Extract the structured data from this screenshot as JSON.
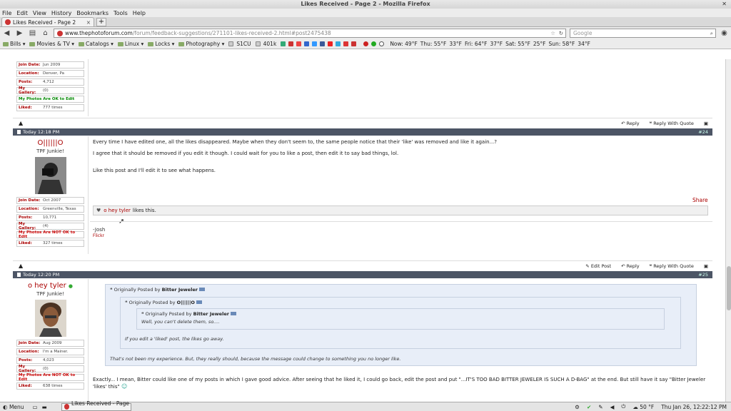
{
  "window": {
    "title": "Likes Received - Page 2 - Mozilla Firefox",
    "close": "✕"
  },
  "menu": [
    "File",
    "Edit",
    "View",
    "History",
    "Bookmarks",
    "Tools",
    "Help"
  ],
  "tab": {
    "label": "Likes Received - Page 2",
    "new_tab": "+",
    "close": "×"
  },
  "nav": {
    "url_domain": "www.thephotoforum.com",
    "url_path": "/forum/feedback-suggestions/271101-likes-received-2.html#post2475438",
    "search_placeholder": "Google"
  },
  "bookmarks": [
    "Bills ▾",
    "Movies & TV ▾",
    "Catalogs ▾",
    "Linux ▾",
    "Locks ▾",
    "Photography ▾",
    "S1CU",
    "401k"
  ],
  "weather": {
    "now": "Now: 49°F",
    "thu": "Thu: 55°F",
    "thu_low": "33°F",
    "fri": "Fri: 64°F",
    "fri_low": "37°F",
    "sat": "Sat: 55°F",
    "sat_low": "25°F",
    "sun": "Sun: 58°F",
    "sun_low": "34°F"
  },
  "stat_labels": {
    "join": "Join Date:",
    "location": "Location:",
    "posts": "Posts:",
    "gallery": "My Gallery:",
    "liked": "Liked:"
  },
  "prev_user": {
    "join": "Jun 2009",
    "location": "Denver, Pa",
    "posts": "4,712",
    "gallery": "(0)",
    "photos": "My Photos Are OK to Edit",
    "liked": "777 times"
  },
  "actions": {
    "reply": "Reply",
    "reply_quote": "Reply With Quote",
    "edit": "Edit Post",
    "share": "Share",
    "likes_this": "likes this."
  },
  "post24": {
    "time": "Today 12:18 PM",
    "number": "#24",
    "user": "O||||||O",
    "user_title": "TPF Junkie!",
    "join": "Oct 2007",
    "location": "Greenville, Texas",
    "posts": "10,771",
    "gallery": "(4)",
    "photos": "My Photos Are NOT OK to Edit",
    "liked": "327 times",
    "p1": "Every time I have edited one, all the likes disappeared. Maybe when they don't seem to, the same people notice that their 'like' was removed and like it again...?",
    "p2": "I agree that it should be removed if you edit it though. I could wait for you to like a post, then edit it to say bad things, lol.",
    "p3": "Like this post and I'll edit it to see what happens.",
    "liker": "o hey tyler",
    "sig1": "-Josh",
    "sig2": "Flickr"
  },
  "post25": {
    "time": "Today 12:20 PM",
    "number": "#25",
    "user": "o hey tyler",
    "user_title": "TPF Junkie!",
    "join": "Aug 2009",
    "location": "I'm a Mainer.",
    "posts": "4,023",
    "gallery": "(0)",
    "photos": "My Photos Are NOT OK to Edit",
    "liked": "638 times",
    "q_prefix": "Originally Posted by",
    "q1_author": "Bitter Jeweler",
    "q2_author": "O||||||O",
    "q3_author": "Bitter Jeweler",
    "q3_text": "Well, you can't delete them, so....",
    "q2_text": "If you edit a 'liked' post, the likes go away.",
    "q1_text": "That's not been my experience. But, they really should, because the message could change to something you no longer like.",
    "body": "Exactly... I mean, Bitter could like one of my posts in which I gave good advice. After seeing that he liked it, I could go back, edit the post and put \"...IT'S TOO BAD BITTER JEWELER IS SUCH A D-BAG\" at the end. But still have it say \"Bitter Jeweler 'likes' this\""
  },
  "taskbar": {
    "menu": "Menu",
    "task": "Likes Received - Page ...",
    "temp": "50 °F",
    "clock": "Thu Jan 26, 12:22:12 PM"
  }
}
